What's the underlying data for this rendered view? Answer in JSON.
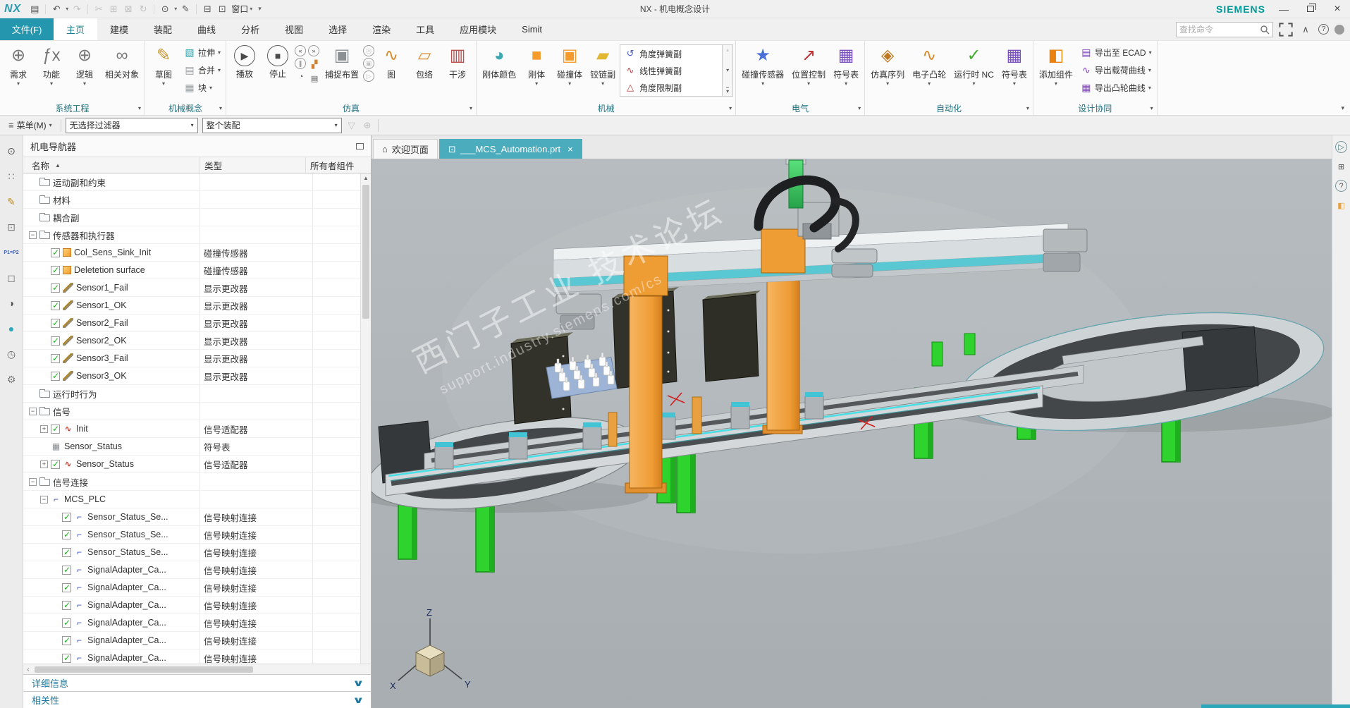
{
  "titlebar": {
    "logo": "NX",
    "app_title": "NX - 机电概念设计",
    "brand": "SIEMENS",
    "window_label": "窗口",
    "quick_access": [
      {
        "icon": "save-icon",
        "glyph": "▤"
      },
      {
        "icon": "undo-icon",
        "glyph": "↶",
        "caret": true
      },
      {
        "icon": "redo-icon",
        "glyph": "↷",
        "disabled": true
      },
      {
        "icon": "cut-icon",
        "glyph": "✂",
        "disabled": true
      },
      {
        "icon": "copy-icon",
        "glyph": "⊞",
        "disabled": true
      },
      {
        "icon": "paste-icon",
        "glyph": "⊠",
        "disabled": true
      },
      {
        "icon": "repeat-command-icon",
        "glyph": "↻",
        "disabled": true
      },
      {
        "icon": "display-mode-icon",
        "glyph": "⊙",
        "caret": true
      },
      {
        "icon": "touch-mode-icon",
        "glyph": "✎"
      },
      {
        "icon": "cascade-window-icon",
        "glyph": "⊟"
      },
      {
        "icon": "new-window-icon",
        "glyph": "⊡"
      }
    ]
  },
  "menu": {
    "file_label": "文件(F)",
    "tabs": [
      {
        "id": "home",
        "label": "主页",
        "active": true
      },
      {
        "id": "modeling",
        "label": "建模",
        "active": false
      },
      {
        "id": "assemblies",
        "label": "装配",
        "active": false
      },
      {
        "id": "curve",
        "label": "曲线",
        "active": false
      },
      {
        "id": "analysis",
        "label": "分析",
        "active": false
      },
      {
        "id": "view",
        "label": "视图",
        "active": false
      },
      {
        "id": "select",
        "label": "选择",
        "active": false
      },
      {
        "id": "render",
        "label": "渲染",
        "active": false
      },
      {
        "id": "tools",
        "label": "工具",
        "active": false
      },
      {
        "id": "application",
        "label": "应用模块",
        "active": false
      },
      {
        "id": "simit",
        "label": "Simit",
        "active": false
      }
    ]
  },
  "search": {
    "placeholder": "查找命令"
  },
  "ribbon": {
    "groups": [
      {
        "label": "系统工程",
        "items": [
          {
            "kind": "large",
            "label": "需求",
            "icon": "requirement-icon",
            "glyph": "⊕",
            "color": "#787878",
            "caret": true
          },
          {
            "kind": "large",
            "label": "功能",
            "icon": "function-icon",
            "glyph": "ƒx",
            "color": "#787878",
            "caret": true
          },
          {
            "kind": "large",
            "label": "逻辑",
            "icon": "logic-icon",
            "glyph": "⊕",
            "color": "#787878",
            "caret": true
          },
          {
            "kind": "large",
            "label": "相关对象",
            "icon": "related-objects-icon",
            "glyph": "∞",
            "color": "#787878",
            "caret": false
          }
        ]
      },
      {
        "label": "机械概念",
        "items": [
          {
            "kind": "large",
            "label": "草图",
            "icon": "sketch-icon",
            "glyph": "✎",
            "color": "#c89428",
            "caret": true
          },
          {
            "kind": "col",
            "buttons": [
              {
                "label": "拉伸",
                "icon": "extrude-icon",
                "glyph": "▧",
                "color": "#2aa7b8",
                "caret": true
              },
              {
                "label": "合并",
                "icon": "unite-icon",
                "glyph": "▤",
                "color": "#9aa0a4",
                "caret": true
              },
              {
                "label": "块",
                "icon": "block-icon",
                "glyph": "▦",
                "color": "#9aa0a4",
                "caret": true
              }
            ]
          }
        ]
      },
      {
        "label": "仿真",
        "items": [
          {
            "kind": "large",
            "circle": true,
            "label": "播放",
            "icon": "play-icon",
            "glyph": "▶",
            "color": "#4a4a4a",
            "caret": false
          },
          {
            "kind": "large",
            "circle": true,
            "label": "停止",
            "icon": "stop-icon",
            "glyph": "■",
            "color": "#4a4a4a",
            "caret": false
          },
          {
            "kind": "minicol",
            "buttons": [
              {
                "icon": "rewind-icon",
                "glyph": "«",
                "circ": true
              },
              {
                "icon": "pause-icon",
                "glyph": "∥",
                "circ": true
              },
              {
                "icon": "play-speed-icon",
                "glyph": "◔",
                "circ": false
              }
            ]
          },
          {
            "kind": "minicol",
            "buttons": [
              {
                "icon": "step-forward-icon",
                "glyph": "»",
                "circ": true
              },
              {
                "icon": "capture-frame-icon",
                "glyph": "▞",
                "color": "#d08030"
              },
              {
                "icon": "save-state-icon",
                "glyph": "▤"
              }
            ]
          },
          {
            "kind": "large",
            "label": "捕捉布置",
            "icon": "capture-arrangement-icon",
            "glyph": "▣",
            "color": "#8a9094",
            "caret": false
          },
          {
            "kind": "minicol",
            "disabled": true,
            "buttons": [
              {
                "icon": "record-movie-icon",
                "glyph": "◎",
                "circ": true
              },
              {
                "icon": "stop-record-icon",
                "glyph": "▣",
                "circ": true
              },
              {
                "icon": "play-movie-icon",
                "glyph": "▷",
                "circ": true
              }
            ]
          },
          {
            "kind": "large",
            "label": "图",
            "icon": "chart-icon",
            "glyph": "∿",
            "color": "#d98a2b",
            "caret": false
          },
          {
            "kind": "large",
            "label": "包络",
            "icon": "envelope-icon",
            "glyph": "▱",
            "color": "#d98a2b",
            "caret": false
          },
          {
            "kind": "large",
            "label": "干涉",
            "icon": "interference-icon",
            "glyph": "▥",
            "color": "#b85050",
            "caret": false
          }
        ]
      },
      {
        "label": "机械",
        "items": [
          {
            "kind": "large",
            "label": "刚体颜色",
            "icon": "rigid-body-color-icon",
            "glyph": "◕",
            "color": "#3fa7b0",
            "caret": false
          },
          {
            "kind": "large",
            "label": "刚体",
            "icon": "rigid-body-icon",
            "glyph": "■",
            "color": "#f59b2d",
            "caret": true
          },
          {
            "kind": "large",
            "label": "碰撞体",
            "icon": "collision-body-icon",
            "glyph": "▣",
            "color": "#f59b2d",
            "caret": true
          },
          {
            "kind": "large",
            "label": "铰链副",
            "icon": "hinge-joint-icon",
            "glyph": "▰",
            "color": "#e0b832",
            "caret": true
          },
          {
            "kind": "gallery",
            "rows": [
              {
                "label": "角度弹簧副",
                "icon": "angular-spring-icon",
                "glyph": "↺",
                "color": "#4a62c8"
              },
              {
                "label": "线性弹簧副",
                "icon": "linear-spring-icon",
                "glyph": "∿",
                "color": "#c23b3b"
              },
              {
                "label": "角度限制副",
                "icon": "angular-limit-icon",
                "glyph": "△",
                "color": "#c23b3b"
              }
            ]
          }
        ]
      },
      {
        "label": "电气",
        "items": [
          {
            "kind": "large",
            "label": "碰撞传感器",
            "icon": "collision-sensor-icon",
            "glyph": "★",
            "color": "#4a6fd8",
            "caret": true
          },
          {
            "kind": "large",
            "label": "位置控制",
            "icon": "position-control-icon",
            "glyph": "↗",
            "color": "#c03030",
            "caret": true
          },
          {
            "kind": "large",
            "label": "符号表",
            "icon": "symbol-table-icon",
            "glyph": "▦",
            "color": "#7a4fc0",
            "caret": true
          }
        ]
      },
      {
        "label": "自动化",
        "items": [
          {
            "kind": "large",
            "label": "仿真序列",
            "icon": "simulation-sequence-icon",
            "glyph": "◈",
            "color": "#c07820",
            "caret": true
          },
          {
            "kind": "large",
            "label": "电子凸轮",
            "icon": "electronic-cam-icon",
            "glyph": "∿",
            "color": "#d98a2b",
            "caret": true
          },
          {
            "kind": "large",
            "label": "运行时 NC",
            "icon": "runtime-nc-icon",
            "glyph": "✓",
            "color": "#3fae29",
            "caret": true
          },
          {
            "kind": "large",
            "label": "符号表",
            "icon": "symbol-table-icon",
            "glyph": "▦",
            "color": "#7a4fc0",
            "caret": true
          }
        ]
      },
      {
        "label": "设计协同",
        "items": [
          {
            "kind": "large",
            "label": "添加组件",
            "icon": "add-component-icon",
            "glyph": "◧",
            "color": "#e8820c",
            "caret": true
          },
          {
            "kind": "col",
            "buttons": [
              {
                "label": "导出至 ECAD",
                "icon": "export-ecad-icon",
                "glyph": "▤",
                "color": "#8040c0",
                "caret": true
              },
              {
                "label": "导出载荷曲线",
                "icon": "export-load-curve-icon",
                "glyph": "∿",
                "color": "#8040c0",
                "caret": true
              },
              {
                "label": "导出凸轮曲线",
                "icon": "export-cam-curve-icon",
                "glyph": "▦",
                "color": "#8040c0",
                "caret": true
              }
            ]
          }
        ]
      }
    ]
  },
  "selection_bar": {
    "menu_label": "菜单(M)",
    "filter_value": "无选择过滤器",
    "scope_value": "整个装配"
  },
  "resource_bar": {
    "items": [
      {
        "icon": "snap-point-icon",
        "glyph": "⊙",
        "color": "#555555"
      },
      {
        "icon": "assembly-navigator-icon",
        "glyph": "∷",
        "color": "#777777"
      },
      {
        "icon": "constraint-navigator-icon",
        "glyph": "✎",
        "color": "#c09020"
      },
      {
        "icon": "part-navigator-icon",
        "glyph": "⊡",
        "color": "#777777"
      },
      {
        "icon": "expressions-icon",
        "glyph": "P1=P2",
        "color": "#3a5fc0",
        "small": true
      },
      {
        "icon": "reuse-library-icon",
        "glyph": "◻",
        "color": "#777777"
      },
      {
        "icon": "hd3d-tools-icon",
        "glyph": "◑",
        "color": "#555555"
      },
      {
        "icon": "web-browser-icon",
        "glyph": "●",
        "color": "#2aa7b8"
      },
      {
        "icon": "history-icon",
        "glyph": "◷",
        "color": "#666666"
      },
      {
        "icon": "roles-icon",
        "glyph": "⚙",
        "color": "#777777"
      }
    ]
  },
  "navigator": {
    "title": "机电导航器",
    "columns": [
      "名称",
      "类型",
      "所有者组件"
    ],
    "details_label": "详细信息",
    "dependencies_label": "相关性",
    "rows": [
      {
        "indent": 0,
        "expand": "",
        "checkbox": false,
        "checked": false,
        "icon": "folder-icon",
        "name": "运动副和约束",
        "type": ""
      },
      {
        "indent": 0,
        "expand": "",
        "checkbox": false,
        "checked": false,
        "icon": "folder-icon",
        "name": "材料",
        "type": ""
      },
      {
        "indent": 0,
        "expand": "",
        "checkbox": false,
        "checked": false,
        "icon": "folder-icon",
        "name": "耦合副",
        "type": ""
      },
      {
        "indent": 0,
        "expand": "minus",
        "checkbox": false,
        "checked": false,
        "icon": "folder-icon",
        "name": "传感器和执行器",
        "type": ""
      },
      {
        "indent": 1,
        "expand": "",
        "checkbox": true,
        "checked": true,
        "icon": "collision-sensor-icon",
        "name": "Col_Sens_Sink_Init",
        "type": "碰撞传感器"
      },
      {
        "indent": 1,
        "expand": "",
        "checkbox": true,
        "checked": true,
        "icon": "collision-sensor-icon",
        "name": "Deletetion surface",
        "type": "碰撞传感器"
      },
      {
        "indent": 1,
        "expand": "",
        "checkbox": true,
        "checked": true,
        "icon": "display-changer-icon",
        "name": "Sensor1_Fail",
        "type": "显示更改器"
      },
      {
        "indent": 1,
        "expand": "",
        "checkbox": true,
        "checked": true,
        "icon": "display-changer-icon",
        "name": "Sensor1_OK",
        "type": "显示更改器"
      },
      {
        "indent": 1,
        "expand": "",
        "checkbox": true,
        "checked": true,
        "icon": "display-changer-icon",
        "name": "Sensor2_Fail",
        "type": "显示更改器"
      },
      {
        "indent": 1,
        "expand": "",
        "checkbox": true,
        "checked": true,
        "icon": "display-changer-icon",
        "name": "Sensor2_OK",
        "type": "显示更改器"
      },
      {
        "indent": 1,
        "expand": "",
        "checkbox": true,
        "checked": true,
        "icon": "display-changer-icon",
        "name": "Sensor3_Fail",
        "type": "显示更改器"
      },
      {
        "indent": 1,
        "expand": "",
        "checkbox": true,
        "checked": true,
        "icon": "display-changer-icon",
        "name": "Sensor3_OK",
        "type": "显示更改器"
      },
      {
        "indent": 0,
        "expand": "",
        "checkbox": false,
        "checked": false,
        "icon": "folder-icon",
        "name": "运行时行为",
        "type": ""
      },
      {
        "indent": 0,
        "expand": "minus",
        "checkbox": false,
        "checked": false,
        "icon": "folder-icon",
        "name": "信号",
        "type": ""
      },
      {
        "indent": 1,
        "expand": "plus",
        "checkbox": true,
        "checked": true,
        "icon": "signal-adapter-icon",
        "name": "Init",
        "type": "信号适配器"
      },
      {
        "indent": 1,
        "expand": "",
        "checkbox": false,
        "checked": false,
        "icon": "symbol-table-icon",
        "name": "Sensor_Status",
        "type": "符号表"
      },
      {
        "indent": 1,
        "expand": "plus",
        "checkbox": true,
        "checked": true,
        "icon": "signal-adapter-icon",
        "name": "Sensor_Status",
        "type": "信号适配器"
      },
      {
        "indent": 0,
        "expand": "minus",
        "checkbox": false,
        "checked": false,
        "icon": "folder-icon",
        "name": "信号连接",
        "type": ""
      },
      {
        "indent": 1,
        "expand": "minus",
        "checkbox": false,
        "checked": false,
        "icon": "signal-connection-icon",
        "name": "MCS_PLC",
        "type": ""
      },
      {
        "indent": 2,
        "expand": "",
        "checkbox": true,
        "checked": true,
        "icon": "signal-connection-icon",
        "name": "Sensor_Status_Se...",
        "type": "信号映射连接"
      },
      {
        "indent": 2,
        "expand": "",
        "checkbox": true,
        "checked": true,
        "icon": "signal-connection-icon",
        "name": "Sensor_Status_Se...",
        "type": "信号映射连接"
      },
      {
        "indent": 2,
        "expand": "",
        "checkbox": true,
        "checked": true,
        "icon": "signal-connection-icon",
        "name": "Sensor_Status_Se...",
        "type": "信号映射连接"
      },
      {
        "indent": 2,
        "expand": "",
        "checkbox": true,
        "checked": true,
        "icon": "signal-connection-icon",
        "name": "SignalAdapter_Ca...",
        "type": "信号映射连接"
      },
      {
        "indent": 2,
        "expand": "",
        "checkbox": true,
        "checked": true,
        "icon": "signal-connection-icon",
        "name": "SignalAdapter_Ca...",
        "type": "信号映射连接"
      },
      {
        "indent": 2,
        "expand": "",
        "checkbox": true,
        "checked": true,
        "icon": "signal-connection-icon",
        "name": "SignalAdapter_Ca...",
        "type": "信号映射连接"
      },
      {
        "indent": 2,
        "expand": "",
        "checkbox": true,
        "checked": true,
        "icon": "signal-connection-icon",
        "name": "SignalAdapter_Ca...",
        "type": "信号映射连接"
      },
      {
        "indent": 2,
        "expand": "",
        "checkbox": true,
        "checked": true,
        "icon": "signal-connection-icon",
        "name": "SignalAdapter_Ca...",
        "type": "信号映射连接"
      },
      {
        "indent": 2,
        "expand": "",
        "checkbox": true,
        "checked": true,
        "icon": "signal-connection-icon",
        "name": "SignalAdapter_Ca...",
        "type": "信号映射连接"
      }
    ]
  },
  "graphics": {
    "doc_tabs": [
      {
        "id": "welcome",
        "icon": "home-icon",
        "glyph": "⌂",
        "label": "欢迎页面",
        "close": false,
        "active": false
      },
      {
        "id": "part",
        "icon": "part-icon",
        "glyph": "⊡",
        "label": "___MCS_Automation.prt",
        "close": true,
        "active": true
      }
    ],
    "watermark_line1": "西门子工业  技术论坛",
    "watermark_line2": "support.industry.siemens.com/cs",
    "triad": {
      "x_label": "X",
      "y_label": "Y",
      "z_label": "Z"
    }
  },
  "right_strip": {
    "items": [
      {
        "icon": "play-animation-icon",
        "glyph": "▷",
        "circ": true,
        "color": "#4a7a80"
      },
      {
        "icon": "information-panel-icon",
        "glyph": "⊞",
        "circ": false,
        "color": "#555555"
      },
      {
        "icon": "help-icon",
        "glyph": "?",
        "circ": true,
        "color": "#555555"
      },
      {
        "icon": "shaded-cube-icon",
        "glyph": "◧",
        "circ": false,
        "color": "#e8a040"
      }
    ]
  },
  "colors": {
    "accent_teal": "#2b9ab0",
    "siemens_teal": "#009999",
    "file_tab": "#2496ad",
    "active_doc_tab": "#4aacbc",
    "gantry_orange": "#f09c3c",
    "conveyor_teal": "#49c8d8",
    "leg_green": "#2ed32e"
  }
}
